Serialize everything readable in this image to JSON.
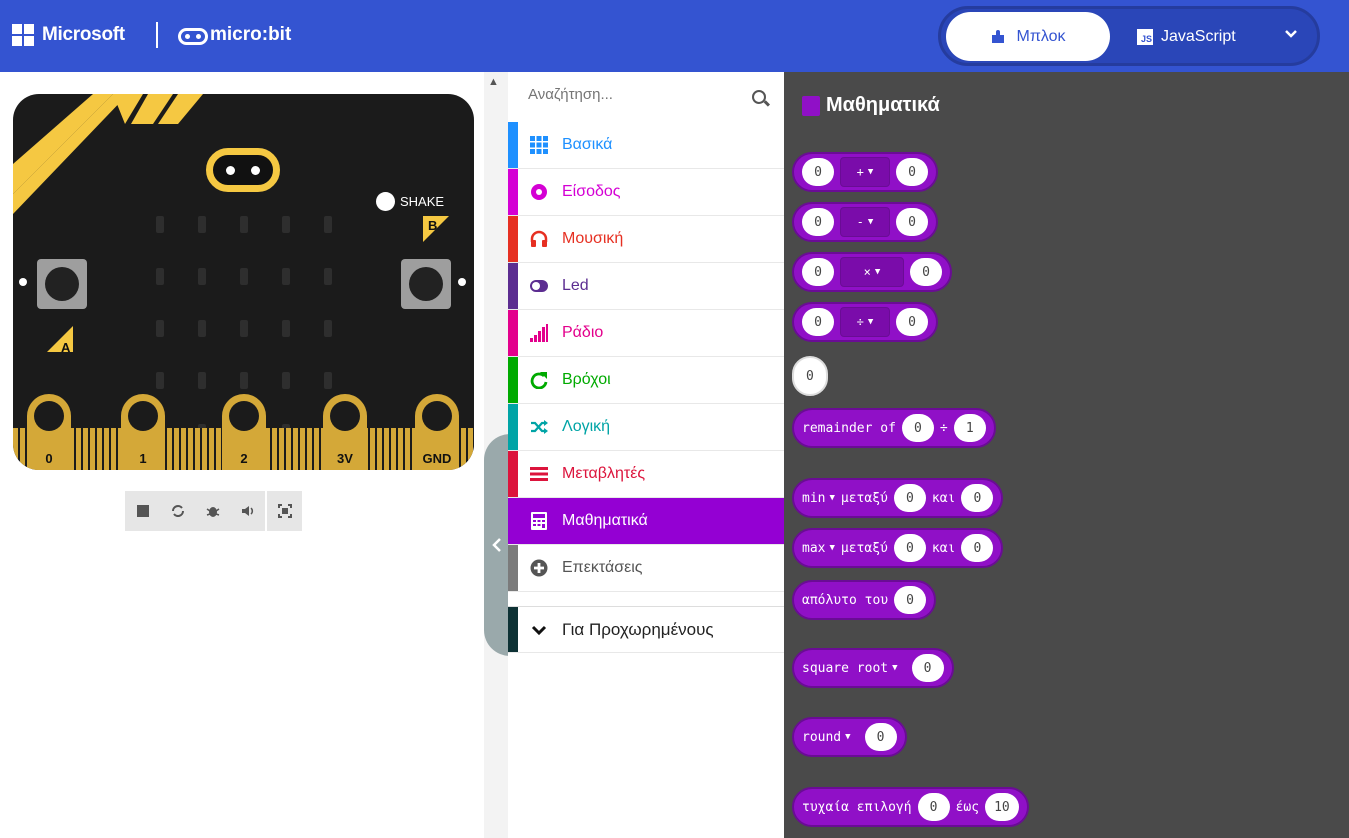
{
  "header": {
    "brand": "Microsoft",
    "product": "micro:bit",
    "tabs": {
      "blocks": "Μπλοκ",
      "javascript": "JavaScript",
      "js_badge": "JS"
    }
  },
  "simulator": {
    "shake_label": "SHAKE",
    "button_a": "A",
    "button_b": "B",
    "pins": [
      "0",
      "1",
      "2",
      "3V",
      "GND"
    ]
  },
  "toolbox": {
    "search_placeholder": "Αναζήτηση...",
    "categories": [
      {
        "label": "Βασικά",
        "color": "#1E90FF",
        "icon": "grid-icon"
      },
      {
        "label": "Είσοδος",
        "color": "#D400D4",
        "icon": "input-icon"
      },
      {
        "label": "Μουσική",
        "color": "#E63022",
        "icon": "headphones-icon"
      },
      {
        "label": "Led",
        "color": "#5C2D91",
        "icon": "toggle-icon"
      },
      {
        "label": "Ράδιο",
        "color": "#E3008C",
        "icon": "signal-icon"
      },
      {
        "label": "Βρόχοι",
        "color": "#00AA00",
        "icon": "loop-icon"
      },
      {
        "label": "Λογική",
        "color": "#00A4A6",
        "icon": "shuffle-icon"
      },
      {
        "label": "Μεταβλητές",
        "color": "#DC143C",
        "icon": "list-icon"
      },
      {
        "label": "Μαθηματικά",
        "color": "#9400D3",
        "icon": "calculator-icon"
      },
      {
        "label": "Επεκτάσεις",
        "color": "#7B7B7B",
        "icon": "plus-circle-icon"
      }
    ],
    "advanced": "Για Προχωρημένους"
  },
  "flyout": {
    "title": "Μαθηματικά",
    "accent": "#9010C7",
    "blocks": {
      "add": {
        "a": "0",
        "op": "+",
        "b": "0"
      },
      "sub": {
        "a": "0",
        "op": "-",
        "b": "0"
      },
      "mul": {
        "a": "0",
        "op": "×",
        "b": "0"
      },
      "div": {
        "a": "0",
        "op": "÷",
        "b": "0"
      },
      "number": "0",
      "remainder": {
        "label": "remainder of",
        "a": "0",
        "op": "÷",
        "b": "1"
      },
      "min": {
        "fn": "min",
        "between": "μεταξύ",
        "and": "και",
        "a": "0",
        "b": "0"
      },
      "max": {
        "fn": "max",
        "between": "μεταξύ",
        "and": "και",
        "a": "0",
        "b": "0"
      },
      "abs": {
        "label": "απόλυτο του",
        "a": "0"
      },
      "sqrt": {
        "fn": "square root",
        "a": "0"
      },
      "round": {
        "fn": "round",
        "a": "0"
      },
      "random": {
        "label": "τυχαία επιλογή",
        "from": "0",
        "to_label": "έως",
        "to": "10"
      }
    }
  }
}
